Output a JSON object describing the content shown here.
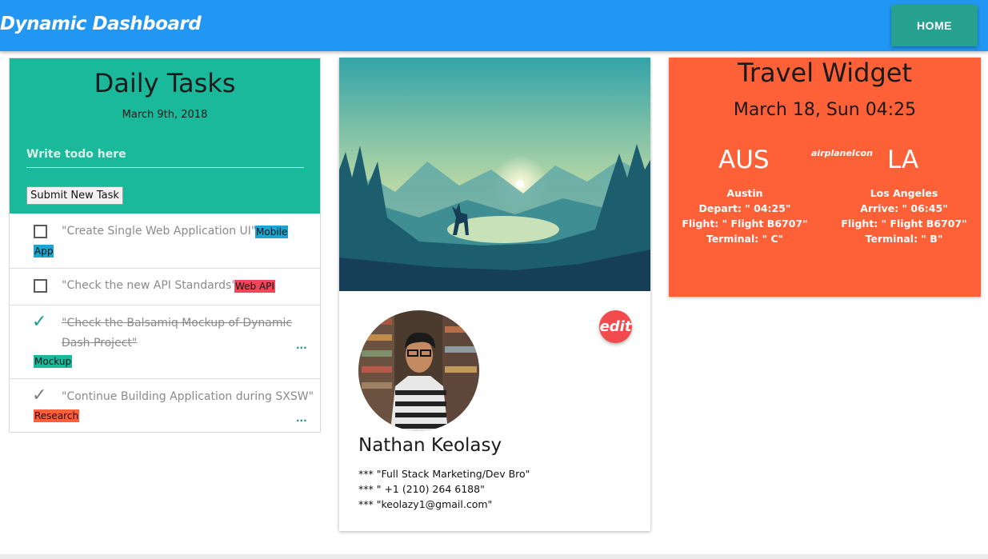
{
  "app": {
    "title": "Dynamic Dashboard",
    "home_label": "HOME"
  },
  "tasks": {
    "title": "Daily Tasks",
    "date": "March 9th, 2018",
    "input_placeholder": "Write todo here",
    "submit_label": "Submit New Task",
    "items": [
      {
        "text": "\"Create Single Web Application UI\"...",
        "tag": "Mobile App",
        "tag_color": "#1ba6cf",
        "done": false,
        "checked_icon": "empty-checkbox-icon"
      },
      {
        "text": "\"Check the new API Standards\"...",
        "tag": "Web API",
        "tag_color": "#f0475a",
        "done": false,
        "checked_icon": "empty-checkbox-icon"
      },
      {
        "text_line1": "\"Check the Balsamiq Mockup of Dynamic",
        "text_line2": "Dash Project\"",
        "tag": "Mockup",
        "tag_color": "#1ab99c",
        "done": true,
        "more": "...",
        "checked_icon": "checkmark-icon"
      },
      {
        "text": "\"Continue Building Application during SXSW\"",
        "tag": "Research",
        "tag_color": "#fe6038",
        "done": false,
        "more": "...",
        "checked_icon": "checkmark-icon"
      }
    ]
  },
  "profile": {
    "name": "Nathan Keolasy",
    "edit_label": "edit",
    "lines": [
      "*** \"Full Stack Marketing/Dev Bro\"",
      "*** \" +1 (210) 264 6188\"",
      "*** \"keolazy1@gmail.com\""
    ]
  },
  "travel": {
    "title": "Travel Widget",
    "date": "March 18, Sun 04:25",
    "from_code": "AUS",
    "to_code": "LA",
    "airplane_label": "airplaneIcon",
    "from": {
      "city": "Austin",
      "time": "Depart: \" 04:25\"",
      "flight": "Flight: \" Flight B6707\"",
      "terminal": "Terminal: \" C\""
    },
    "to": {
      "city": "Los Angeles",
      "time": "Arrive: \" 06:45\"",
      "flight": "Flight: \" Flight B6707\"",
      "terminal": "Terminal: \" B\""
    }
  },
  "colors": {
    "appbar": "#2196f3",
    "home_button": "#26a08f",
    "tasks_header": "#1ab99c",
    "travel_card": "#fe6038",
    "edit_button": "#f24b4e"
  }
}
